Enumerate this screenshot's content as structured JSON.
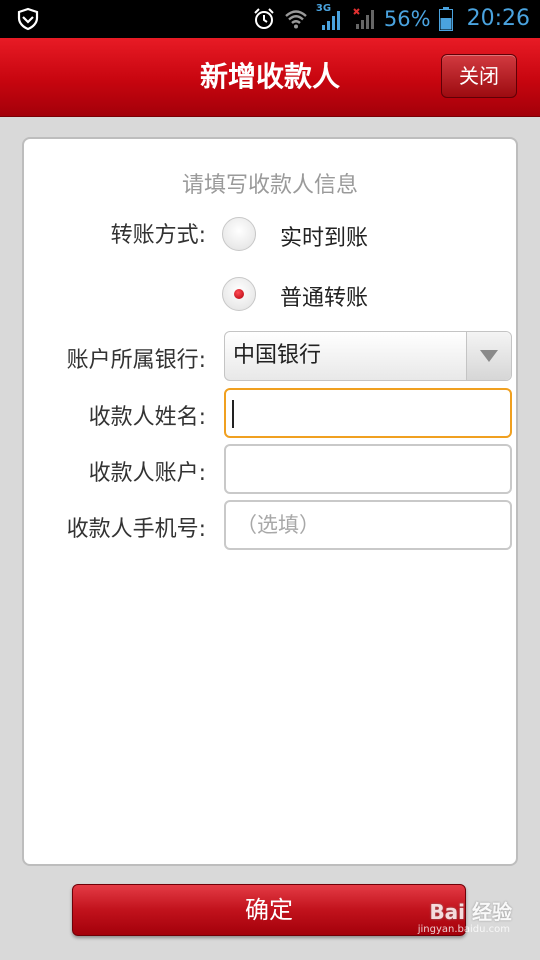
{
  "status_bar": {
    "network": "3G",
    "battery": "56%",
    "time": "20:26"
  },
  "header": {
    "title": "新增收款人",
    "close_label": "关闭"
  },
  "form": {
    "title": "请填写收款人信息",
    "transfer_method_label": "转账方式:",
    "transfer_options": [
      {
        "label": "实时到账",
        "selected": false
      },
      {
        "label": "普通转账",
        "selected": true
      }
    ],
    "bank_label": "账户所属银行:",
    "bank_value": "中国银行",
    "name_label": "收款人姓名:",
    "name_value": "",
    "account_label": "收款人账户:",
    "account_value": "",
    "phone_label": "收款人手机号:",
    "phone_placeholder": "（选填）"
  },
  "confirm_label": "确定",
  "watermark": {
    "brand": "Bai 经验",
    "url": "jingyan.baidu.com"
  },
  "colors": {
    "header_red": "#c7050f",
    "focus_border": "#f0a020",
    "status_blue": "#4aa3df"
  }
}
